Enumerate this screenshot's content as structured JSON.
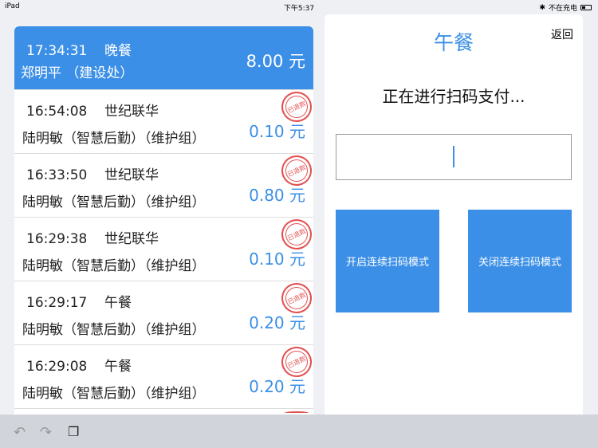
{
  "status": {
    "device": "iPad",
    "time": "下午5:37",
    "charging": "不在充电"
  },
  "orders": [
    {
      "time": "17:34:31",
      "type": "晚餐",
      "name": "郑明平 （建设处）",
      "amount": "8.00 元",
      "refunded": false
    },
    {
      "time": "16:54:08",
      "type": "世纪联华",
      "name": "陆明敏（智慧后勤）（维护组）",
      "amount": "0.10 元",
      "refunded": true
    },
    {
      "time": "16:33:50",
      "type": "世纪联华",
      "name": "陆明敏（智慧后勤）（维护组）",
      "amount": "0.80 元",
      "refunded": true
    },
    {
      "time": "16:29:38",
      "type": "世纪联华",
      "name": "陆明敏（智慧后勤）（维护组）",
      "amount": "0.10 元",
      "refunded": true
    },
    {
      "time": "16:29:17",
      "type": "午餐",
      "name": "陆明敏（智慧后勤）（维护组）",
      "amount": "0.20 元",
      "refunded": true
    },
    {
      "time": "16:29:08",
      "type": "午餐",
      "name": "陆明敏（智慧后勤）（维护组）",
      "amount": "0.20 元",
      "refunded": true
    }
  ],
  "stamp_text": "已退款",
  "panel": {
    "title": "午餐",
    "back": "返回",
    "message": "正在进行扫码支付...",
    "scan_value": "",
    "btn_on": "开启连续扫码模式",
    "btn_off": "关闭连续扫码模式"
  },
  "colors": {
    "accent": "#3b8fe6",
    "stamp": "#dd3333"
  }
}
